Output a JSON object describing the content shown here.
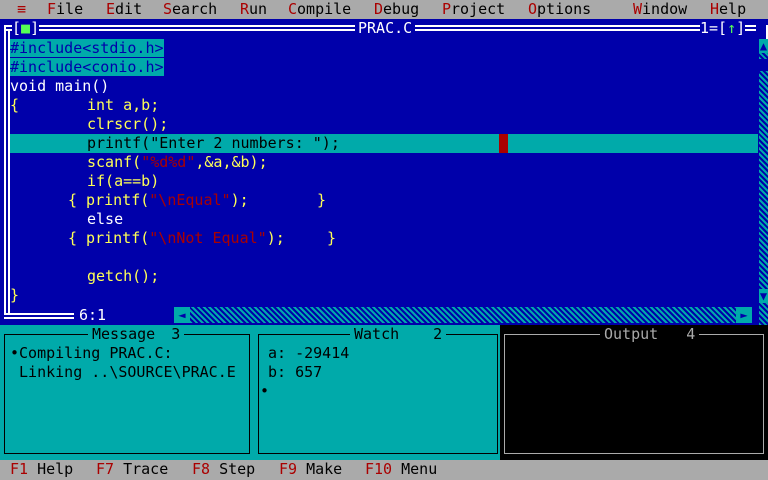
{
  "menubar": {
    "system_icon": "≡",
    "items": [
      {
        "hot": "F",
        "rest": "ile"
      },
      {
        "hot": "E",
        "rest": "dit"
      },
      {
        "hot": "S",
        "rest": "earch"
      },
      {
        "hot": "R",
        "rest": "un"
      },
      {
        "hot": "C",
        "rest": "ompile"
      },
      {
        "hot": "D",
        "rest": "ebug"
      },
      {
        "hot": "P",
        "rest": "roject"
      },
      {
        "hot": "O",
        "rest": "ptions"
      },
      {
        "hot": "W",
        "rest": "indow"
      },
      {
        "hot": "H",
        "rest": "elp"
      }
    ]
  },
  "editor": {
    "close_box": "[",
    "close_mark": "■",
    "close_box_end": "]",
    "title": "PRAC.C",
    "window_number": "1=[",
    "zoom_mark": "↑",
    "zoom_end": "]",
    "cursor_position": "6:1",
    "code": {
      "l1": "#include<stdio.h>",
      "l2": "#include<conio.h>",
      "l3": "void main()",
      "l4a": "{",
      "l4b": "int a,b;",
      "l5": "clrscr();",
      "l6": "printf(\"Enter 2 numbers: \");",
      "l7a": "scanf(",
      "l7s": "\"%d%d\"",
      "l7b": ",&a,&b);",
      "l8": "if(a==b)",
      "l9a": "{ printf(",
      "l9s": "\"\\nEqual\"",
      "l9b": ");",
      "l9c": "}",
      "l10": "else",
      "l11a": "{ printf(",
      "l11s": "\"\\nNot Equal\"",
      "l11b": ");",
      "l11c": "}",
      "l12": "getch();",
      "l13": "}"
    }
  },
  "message_pane": {
    "title": "Message",
    "number": "3",
    "lines": [
      "•Compiling PRAC.C:",
      " Linking ..\\SOURCE\\PRAC.E"
    ]
  },
  "watch_pane": {
    "title": "Watch",
    "number": "2",
    "lines": [
      "a: -29414",
      "b: 657",
      "•"
    ]
  },
  "output_pane": {
    "title": "Output",
    "number": "4"
  },
  "statusbar": {
    "items": [
      {
        "key": "F1",
        "label": " Help"
      },
      {
        "key": "F7",
        "label": " Trace"
      },
      {
        "key": "F8",
        "label": " Step"
      },
      {
        "key": "F9",
        "label": " Make"
      },
      {
        "key": "F10",
        "label": " Menu"
      }
    ]
  },
  "colors": {
    "editor_bg": "#0000aa",
    "highlight": "#00aaaa",
    "code_text": "#ffff55",
    "string_text": "#aa0000",
    "menu_bg": "#aaaaaa"
  }
}
